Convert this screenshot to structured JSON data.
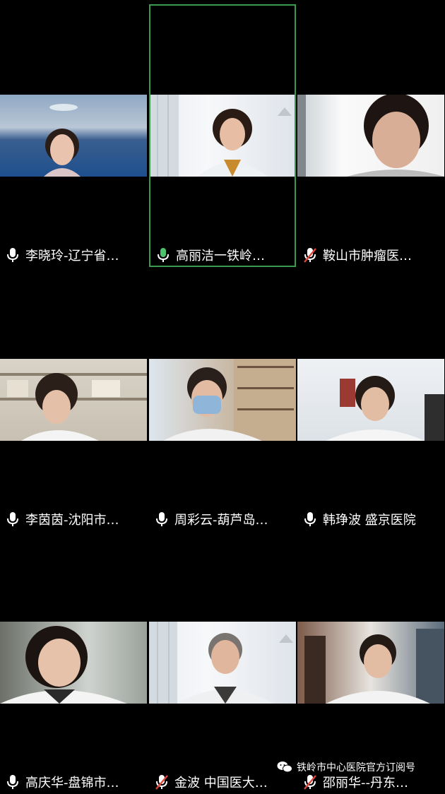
{
  "participants": [
    {
      "name": "李晓玲-辽宁省…",
      "mic": "on"
    },
    {
      "name": "高丽洁一铁岭…",
      "mic": "on"
    },
    {
      "name": "鞍山市肿瘤医…",
      "mic": "muted"
    },
    {
      "name": "李茵茵-沈阳市…",
      "mic": "on"
    },
    {
      "name": "周彩云-葫芦岛…",
      "mic": "on"
    },
    {
      "name": "韩琤波 盛京医院",
      "mic": "on"
    },
    {
      "name": "高庆华-盘锦市…",
      "mic": "on"
    },
    {
      "name": "金波 中国医大…",
      "mic": "muted"
    },
    {
      "name": "邵丽华--丹东…",
      "mic": "muted"
    }
  ],
  "active_speaker_index": 1,
  "watermark": {
    "text": "铁岭市中心医院官方订阅号",
    "icon": "wechat-icon"
  },
  "colors": {
    "active_border": "#3a9a4e",
    "muted_slash": "#e0453a",
    "background": "#000000"
  }
}
